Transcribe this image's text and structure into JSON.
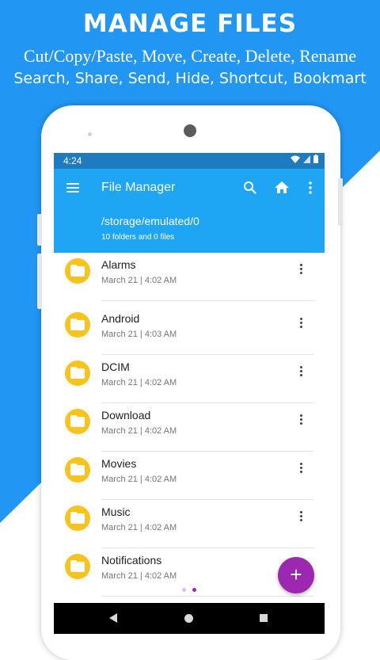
{
  "promo": {
    "title": "MANAGE FILES",
    "line1": "Cut/Copy/Paste, Move, Create, Delete, Rename",
    "line2": "Search, Share, Send, Hide, Shortcut, Bookmart",
    "background_color": "#2196f3"
  },
  "status_bar": {
    "time": "4:24",
    "color": "#1e7bc0"
  },
  "app_bar": {
    "title": "File Manager",
    "path": "/storage/emulated/0",
    "summary": "10 folders and 0 files",
    "color": "#1ea6f5",
    "icons": [
      "menu-icon",
      "search-icon",
      "home-icon",
      "more-vert-icon"
    ]
  },
  "folders": [
    {
      "name": "Alarms",
      "date": "March 21 | 4:02 AM"
    },
    {
      "name": "Android",
      "date": "March 21 | 4:03 AM"
    },
    {
      "name": "DCIM",
      "date": "March 21 | 4:02 AM"
    },
    {
      "name": "Download",
      "date": "March 21 | 4:02 AM"
    },
    {
      "name": "Movies",
      "date": "March 21 | 4:02 AM"
    },
    {
      "name": "Music",
      "date": "March 21 | 4:02 AM"
    },
    {
      "name": "Notifications",
      "date": "March 21 | 4:02 AM"
    }
  ],
  "folder_icon_color": "#f8c31a",
  "fab": {
    "label": "+",
    "color": "#9c27b0"
  },
  "page_indicator": {
    "count": 2,
    "active": 1
  }
}
